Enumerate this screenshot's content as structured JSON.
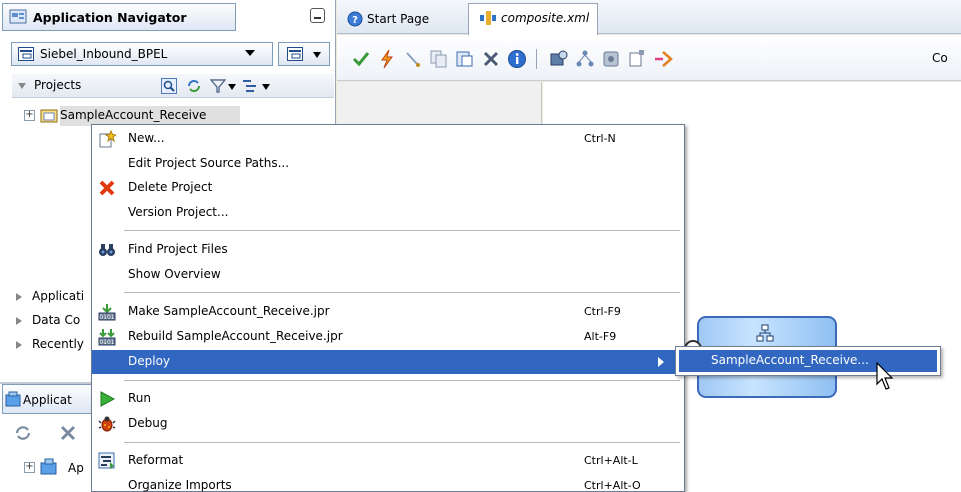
{
  "navigator": {
    "title": "Application Navigator",
    "project_selector": "Siebel_Inbound_BPEL",
    "projects_label": "Projects",
    "tree": [
      {
        "label": "SampleAccount_Receive",
        "expanded": false
      }
    ],
    "accordions": [
      {
        "label": "Applicati"
      },
      {
        "label": "Data Co"
      },
      {
        "label": "Recently"
      }
    ]
  },
  "applications_panel": {
    "title": "Applicat",
    "tree_item": "Ap"
  },
  "editor": {
    "tabs": [
      {
        "label": "Start Page",
        "active": false
      },
      {
        "label": "composite.xml",
        "active": true
      }
    ],
    "toolbar_trailing_text": "Co"
  },
  "context_menu": {
    "items": [
      {
        "label": "New...",
        "shortcut": "Ctrl-N",
        "icon": "new-icon"
      },
      {
        "label": "Edit Project Source Paths...",
        "shortcut": ""
      },
      {
        "label": "Delete Project",
        "shortcut": "",
        "icon": "delete-icon"
      },
      {
        "label": "Version Project...",
        "shortcut": ""
      },
      {
        "label": "Find Project Files",
        "shortcut": "",
        "icon": "binoculars-icon"
      },
      {
        "label": "Show Overview",
        "shortcut": ""
      },
      {
        "label": "Make SampleAccount_Receive.jpr",
        "shortcut": "Ctrl-F9",
        "icon": "make-icon"
      },
      {
        "label": "Rebuild SampleAccount_Receive.jpr",
        "shortcut": "Alt-F9",
        "icon": "rebuild-icon"
      },
      {
        "label": "Deploy",
        "shortcut": "",
        "highlighted": true,
        "has_submenu": true
      },
      {
        "label": "Run",
        "shortcut": "",
        "icon": "run-icon"
      },
      {
        "label": "Debug",
        "shortcut": "",
        "icon": "debug-icon"
      },
      {
        "label": "Reformat",
        "shortcut": "Ctrl+Alt-L",
        "icon": "reformat-icon"
      },
      {
        "label": "Organize Imports",
        "shortcut": "Ctrl+Alt-O"
      }
    ],
    "submenu": {
      "items": [
        {
          "label": "SampleAccount_Receive...",
          "highlighted": true
        }
      ]
    }
  },
  "colors": {
    "menu_highlight": "#3166c1",
    "panel_background": "#ece9d8",
    "component_fill": "#9fc8f4",
    "component_border": "#3d6ab8"
  }
}
